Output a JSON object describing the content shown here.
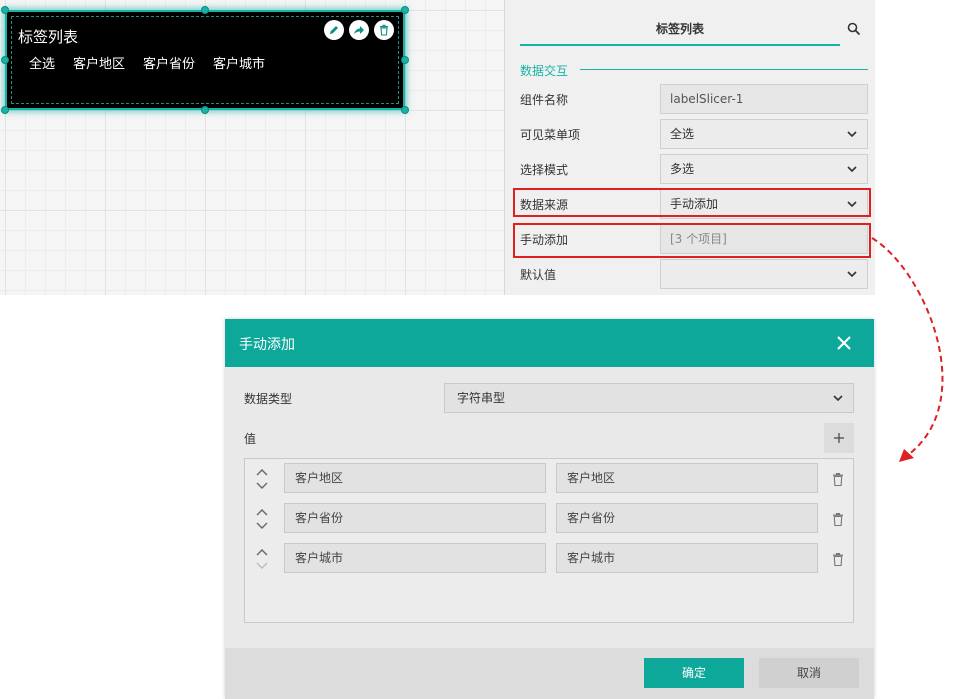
{
  "widget": {
    "title": "标签列表",
    "items": [
      "全选",
      "客户地区",
      "客户省份",
      "客户城市"
    ],
    "actions": [
      "edit-icon",
      "share-icon",
      "trash-icon"
    ],
    "accent": "#16b3a6"
  },
  "panel": {
    "tab_label": "标签列表",
    "section_label": "数据交互",
    "rows": {
      "component_name": {
        "label": "组件名称",
        "value": "labelSlicer-1"
      },
      "visible_items": {
        "label": "可见菜单项",
        "value": "全选"
      },
      "select_mode": {
        "label": "选择模式",
        "value": "多选"
      },
      "data_source": {
        "label": "数据来源",
        "value": "手动添加"
      },
      "manual_add": {
        "label": "手动添加",
        "value": "[3 个项目]"
      },
      "default_value": {
        "label": "默认值",
        "value": ""
      }
    },
    "highlight_color": "#e02020"
  },
  "dialog": {
    "title": "手动添加",
    "data_type_label": "数据类型",
    "data_type_value": "字符串型",
    "values_label": "值",
    "rows": [
      {
        "key": "客户地区",
        "value": "客户地区"
      },
      {
        "key": "客户省份",
        "value": "客户省份"
      },
      {
        "key": "客户城市",
        "value": "客户城市"
      }
    ],
    "ok_label": "确定",
    "cancel_label": "取消",
    "header_color": "#0ea89b"
  }
}
